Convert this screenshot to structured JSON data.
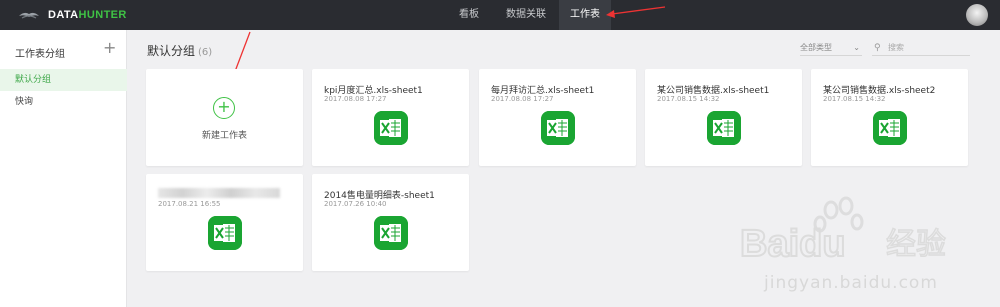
{
  "brand": {
    "name_prefix": "DATA",
    "name_accent": "HUNTER",
    "accent_color": "#3fc245",
    "topbar_color": "#2a2c31"
  },
  "nav": {
    "items": [
      {
        "label": "看板"
      },
      {
        "label": "数据关联"
      },
      {
        "label": "工作表",
        "active": true
      }
    ]
  },
  "sidebar": {
    "header": "工作表分组",
    "add_icon": "plus-icon",
    "items": [
      {
        "label": "默认分组",
        "active": true
      },
      {
        "label": "快询"
      }
    ]
  },
  "main": {
    "group_title": "默认分组",
    "group_count": "(6)",
    "filter": {
      "selected": "全部类型",
      "icon": "chevron-down-icon"
    },
    "search": {
      "placeholder": "搜索",
      "icon": "search-icon"
    },
    "new_card_label": "新建工作表",
    "cards": [
      {
        "title": "kpi月度汇总.xls-sheet1",
        "date": "2017.08.08 17:27"
      },
      {
        "title": "每月拜访汇总.xls-sheet1",
        "date": "2017.08.08 17:27"
      },
      {
        "title": "某公司销售数据.xls-sheet1",
        "date": "2017.08.15 14:32"
      },
      {
        "title": "某公司销售数据.xls-sheet2",
        "date": "2017.08.15 14:32"
      },
      {
        "title": "",
        "date": "2017.08.21 16:55",
        "title_blurred": true
      },
      {
        "title": "2014售电量明细表-sheet1",
        "date": "2017.07.26 10:40"
      }
    ],
    "file_icon": "excel-icon"
  },
  "watermark": {
    "brand": "Baidu",
    "text": "经验",
    "url": "jingyan.baidu.com"
  }
}
